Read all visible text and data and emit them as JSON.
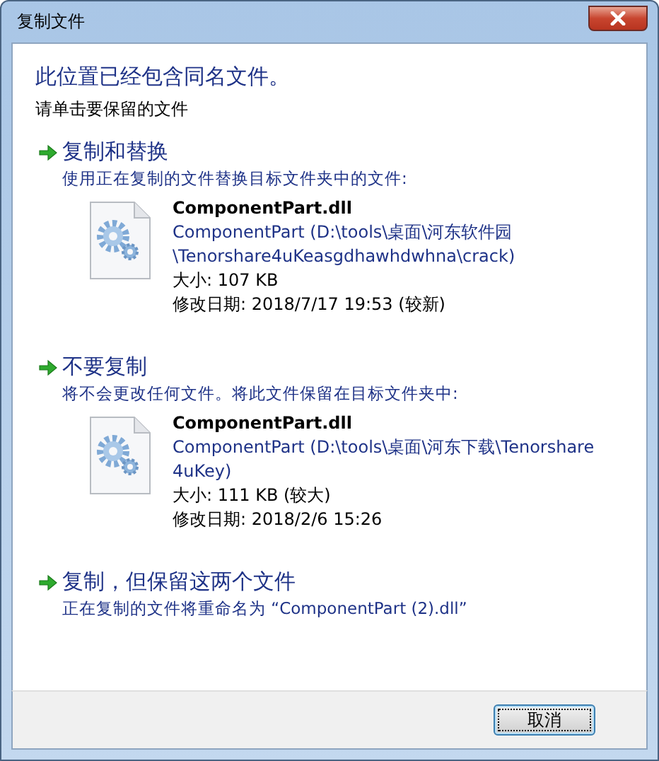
{
  "window": {
    "title": "复制文件"
  },
  "heading": "此位置已经包含同名文件。",
  "instruction": "请单击要保留的文件",
  "options": [
    {
      "title": "复制和替换",
      "description": "使用正在复制的文件替换目标文件夹中的文件:",
      "file": {
        "name": "ComponentPart.dll",
        "location_lines": [
          "ComponentPart (D:\\tools\\桌面\\河东软件园",
          "\\Tenorshare4uKeasgdhawhdwhna\\crack)"
        ],
        "size": "大小: 107 KB",
        "modified": "修改日期: 2018/7/17 19:53 (较新)"
      }
    },
    {
      "title": "不要复制",
      "description": "将不会更改任何文件。将此文件保留在目标文件夹中:",
      "file": {
        "name": "ComponentPart.dll",
        "location_lines": [
          "ComponentPart (D:\\tools\\桌面\\河东下载\\Tenorshare",
          "4uKey)"
        ],
        "size": "大小: 111 KB (较大)",
        "modified": "修改日期: 2018/2/6 15:26"
      }
    },
    {
      "title": "复制，但保留这两个文件",
      "description": "正在复制的文件将重命名为 “ComponentPart (2).dll”"
    }
  ],
  "buttons": [
    {
      "label": "取消",
      "focused": true
    }
  ]
}
